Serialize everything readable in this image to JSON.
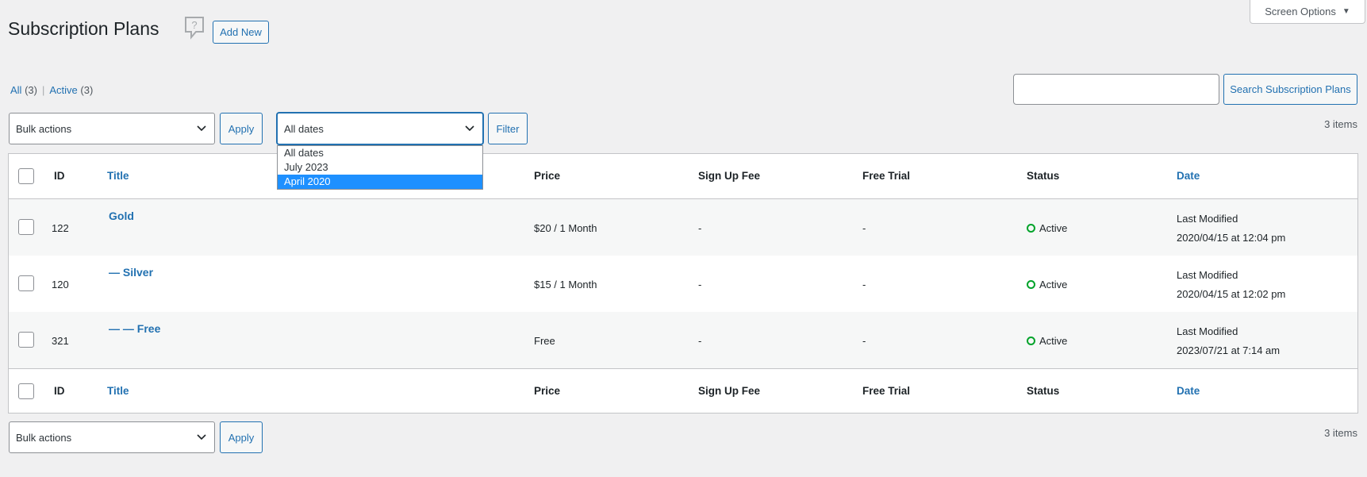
{
  "screen_options": {
    "label": "Screen Options"
  },
  "header": {
    "title": "Subscription Plans",
    "add_new": "Add New"
  },
  "views": [
    {
      "label": "All",
      "count": "(3)"
    },
    {
      "label": "Active",
      "count": "(3)"
    }
  ],
  "search": {
    "value": "",
    "button": "Search Subscription Plans"
  },
  "toolbar_top": {
    "bulk_actions": "Bulk actions",
    "apply": "Apply",
    "dates_selected": "All dates",
    "filter": "Filter",
    "items": "3 items"
  },
  "dates_options": [
    "All dates",
    "July 2023",
    "April 2020"
  ],
  "dates_highlighted": "April 2020",
  "columns": {
    "id": "ID",
    "title": "Title",
    "price": "Price",
    "sign_up_fee": "Sign Up Fee",
    "free_trial": "Free Trial",
    "status": "Status",
    "date": "Date"
  },
  "rows": [
    {
      "id": "122",
      "title": "Gold",
      "price": "$20 / 1 Month",
      "sign_up_fee": "-",
      "free_trial": "-",
      "status": "Active",
      "date_label": "Last Modified",
      "date": "2020/04/15 at 12:04 pm"
    },
    {
      "id": "120",
      "title": "— Silver",
      "price": "$15 / 1 Month",
      "sign_up_fee": "-",
      "free_trial": "-",
      "status": "Active",
      "date_label": "Last Modified",
      "date": "2020/04/15 at 12:02 pm"
    },
    {
      "id": "321",
      "title": "— — Free",
      "price": "Free",
      "sign_up_fee": "-",
      "free_trial": "-",
      "status": "Active",
      "date_label": "Last Modified",
      "date": "2023/07/21 at 7:14 am"
    }
  ],
  "toolbar_bottom": {
    "bulk_actions": "Bulk actions",
    "apply": "Apply",
    "items": "3 items"
  },
  "colors": {
    "link": "#2271b1",
    "active_status": "#00a32a",
    "highlight": "#1e90ff"
  }
}
